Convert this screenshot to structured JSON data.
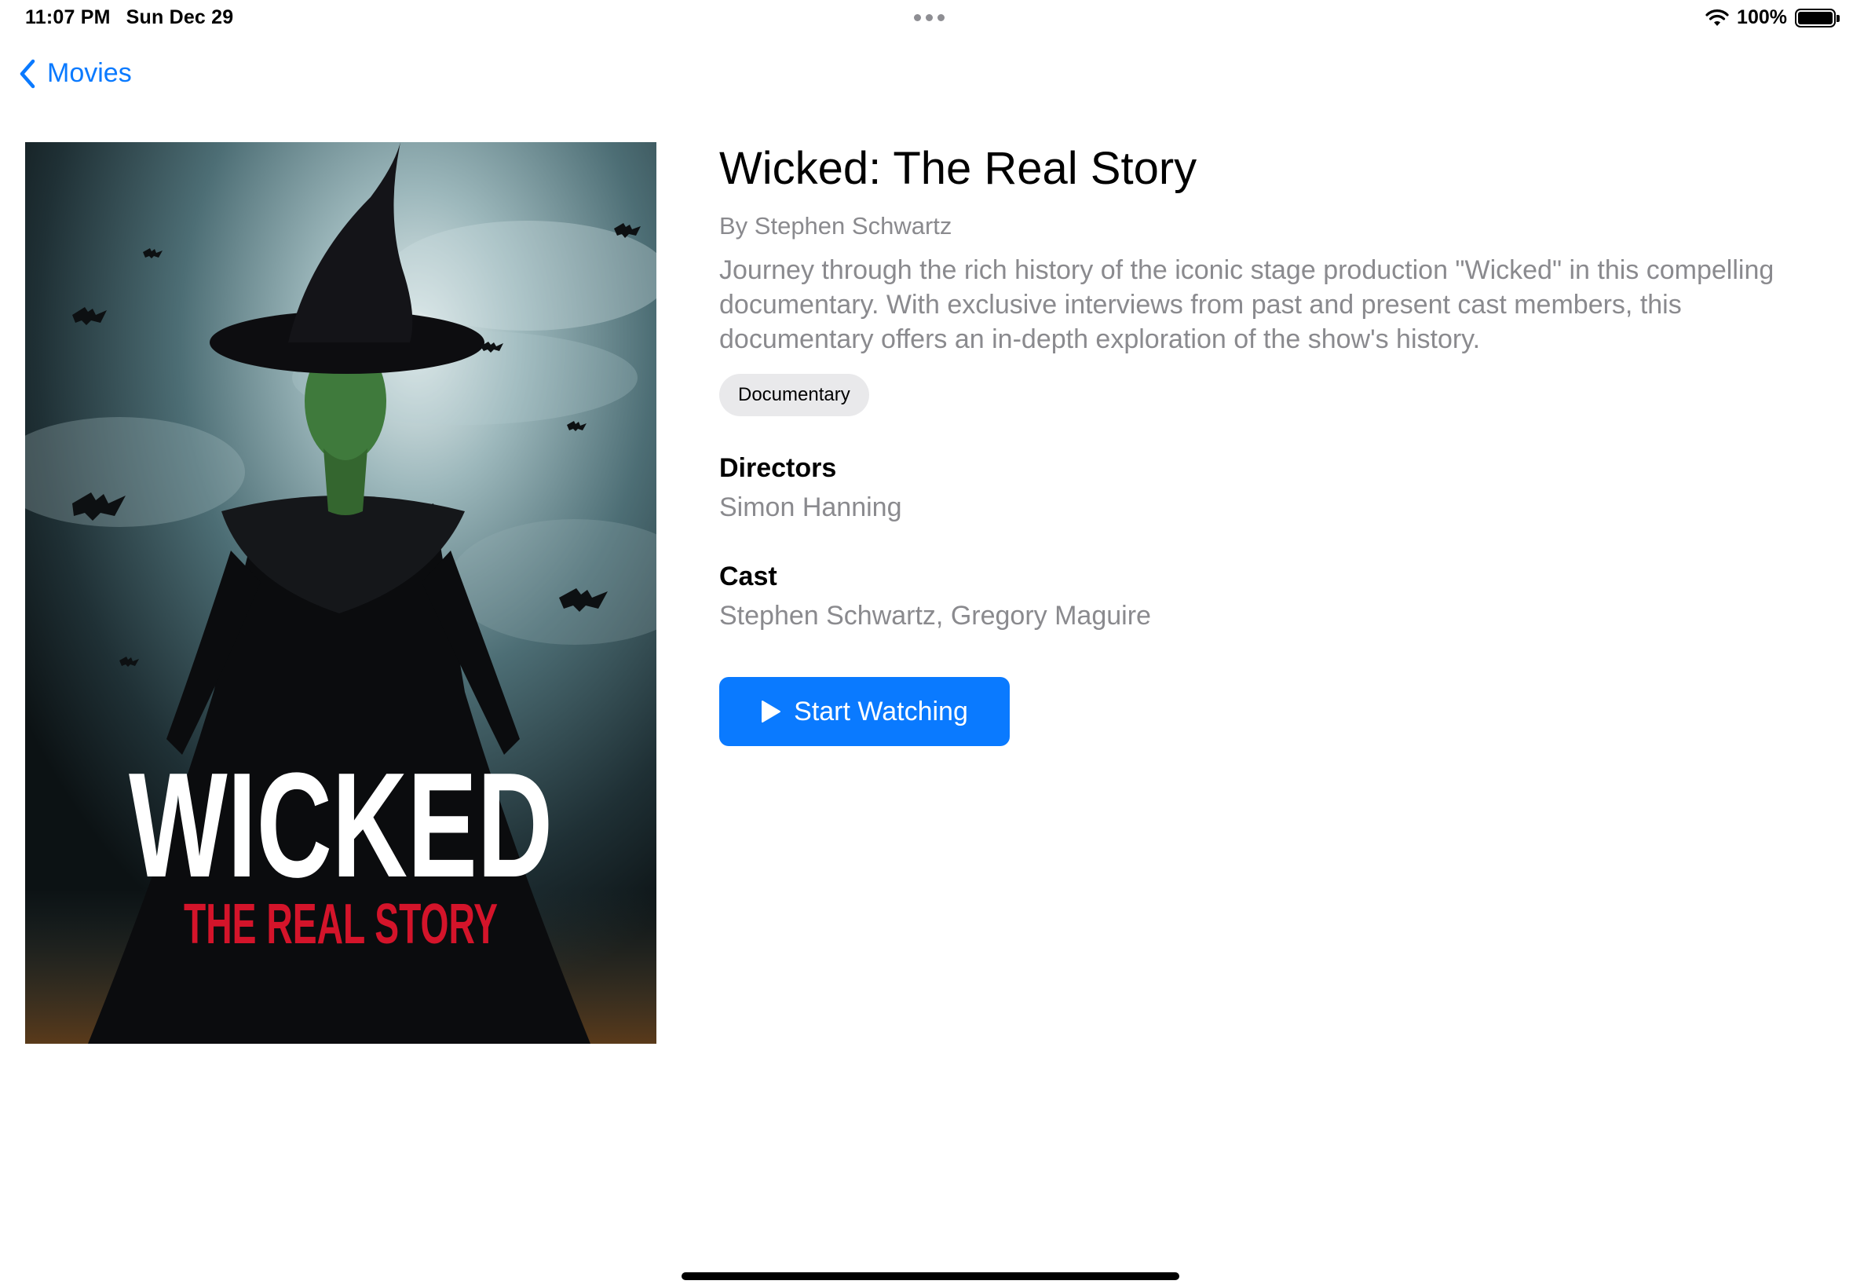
{
  "status_bar": {
    "time": "11:07 PM",
    "date": "Sun Dec 29",
    "battery_percent": "100%",
    "battery_level": 1.0
  },
  "nav": {
    "back_label": "Movies"
  },
  "movie": {
    "poster": {
      "title_word": "WICKED",
      "subtitle": "THE REAL STORY"
    },
    "title": "Wicked: The Real Story",
    "byline": "By Stephen Schwartz",
    "description": "Journey through the rich history of the iconic stage production \"Wicked\" in this compelling documentary. With exclusive interviews from past and present cast members, this documentary offers an in-depth exploration of the show's history.",
    "genre": "Documentary",
    "directors_label": "Directors",
    "directors": "Simon Hanning",
    "cast_label": "Cast",
    "cast": "Stephen Schwartz, Gregory Maguire",
    "cta_label": "Start Watching"
  },
  "colors": {
    "accent": "#0a7aff",
    "secondary_text": "#8a8a8e",
    "chip_bg": "#e9e9eb",
    "poster_title_red": "#d4142a"
  },
  "icons": {
    "back": "chevron-left-icon",
    "wifi": "wifi-icon",
    "battery": "battery-icon",
    "play": "play-icon",
    "multitasking": "more-dots-icon"
  }
}
